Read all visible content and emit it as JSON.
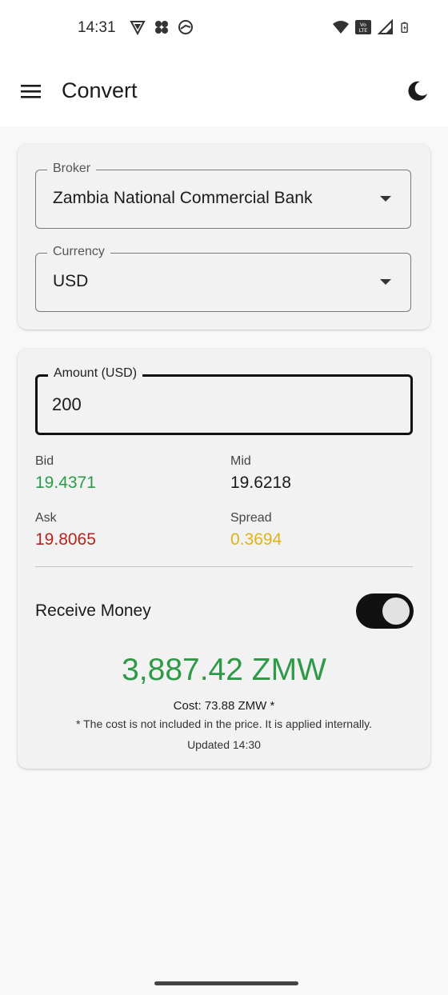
{
  "status_bar": {
    "time": "14:31",
    "left_icons": [
      "vpn-shield-icon",
      "app-clover-icon",
      "sync-globe-icon"
    ],
    "right_icons": [
      "wifi-icon",
      "volte-icon",
      "signal-icon",
      "battery-charging-icon"
    ],
    "volte_text": "Vo LTE"
  },
  "app_bar": {
    "title": "Convert",
    "menu_icon": "hamburger-menu-icon",
    "theme_icon": "moon-icon"
  },
  "selection": {
    "broker_label": "Broker",
    "broker_value": "Zambia National Commercial Bank",
    "currency_label": "Currency",
    "currency_value": "USD"
  },
  "amount": {
    "label": "Amount (USD)",
    "value": "200"
  },
  "rates": {
    "bid_label": "Bid",
    "bid_value": "19.4371",
    "mid_label": "Mid",
    "mid_value": "19.6218",
    "ask_label": "Ask",
    "ask_value": "19.8065",
    "spread_label": "Spread",
    "spread_value": "0.3694"
  },
  "receive": {
    "label": "Receive Money",
    "enabled": true
  },
  "result": {
    "amount": "3,887.42 ZMW",
    "cost": "Cost: 73.88 ZMW *",
    "note": "* The cost is not included in the price. It is applied internally.",
    "updated": "Updated 14:30"
  },
  "colors": {
    "bid": "#2e9a47",
    "mid": "#1b1b1b",
    "ask": "#b3261e",
    "spread": "#e0b318",
    "result": "#2e9a47",
    "toggle_track": "#111111"
  }
}
